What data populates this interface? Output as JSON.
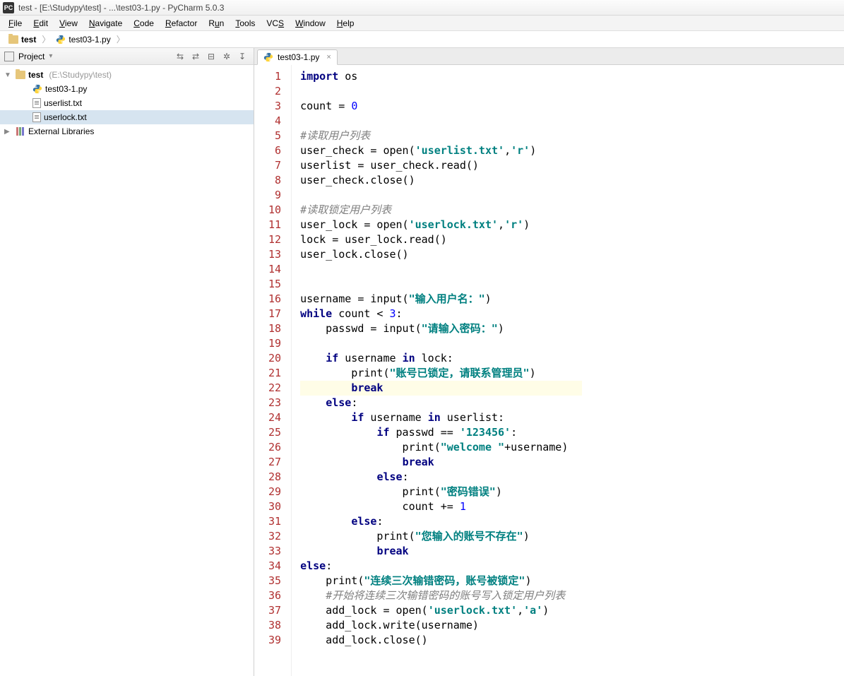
{
  "window": {
    "app_icon_text": "PC",
    "title": "test - [E:\\Studypy\\test] - ...\\test03-1.py - PyCharm 5.0.3"
  },
  "menu": [
    "File",
    "Edit",
    "View",
    "Navigate",
    "Code",
    "Refactor",
    "Run",
    "Tools",
    "VCS",
    "Window",
    "Help"
  ],
  "breadcrumb": {
    "root": "test",
    "file": "test03-1.py"
  },
  "sidebar": {
    "header": {
      "label": "Project",
      "combo": "Project"
    },
    "tree": {
      "root_name": "test",
      "root_path": "(E:\\Studypy\\test)",
      "children": [
        "test03-1.py",
        "userlist.txt",
        "userlock.txt"
      ],
      "external": "External Libraries"
    }
  },
  "editor": {
    "tab_label": "test03-1.py",
    "highlight_line": 22,
    "lines": 39
  },
  "code": {
    "l1": {
      "kw1": "import",
      "t": " os"
    },
    "l3": {
      "t1": "count = ",
      "n": "0"
    },
    "l5": "#读取用户列表",
    "l6": {
      "t1": "user_check = open(",
      "s1": "'userlist.txt'",
      "t2": ",",
      "s2": "'r'",
      "t3": ")"
    },
    "l7": "userlist = user_check.read()",
    "l8": "user_check.close()",
    "l10": "#读取锁定用户列表",
    "l11": {
      "t1": "user_lock = open(",
      "s1": "'userlock.txt'",
      "t2": ",",
      "s2": "'r'",
      "t3": ")"
    },
    "l12": "lock = user_lock.read()",
    "l13": "user_lock.close()",
    "l16": {
      "t1": "username = input(",
      "s": "\"输入用户名：\"",
      "t2": ")"
    },
    "l17": {
      "kw": "while",
      "t1": " count < ",
      "n": "3",
      "t2": ":"
    },
    "l18": {
      "pad": "    ",
      "t1": "passwd = input(",
      "s": "\"请输入密码：\"",
      "t2": ")"
    },
    "l20": {
      "pad": "    ",
      "kw1": "if",
      "t1": " username ",
      "kw2": "in",
      "t2": " lock:"
    },
    "l21": {
      "pad": "        ",
      "t1": "print(",
      "s": "\"账号已锁定，请联系管理员\"",
      "t2": ")"
    },
    "l22": {
      "pad": "        ",
      "kw": "break"
    },
    "l23": {
      "pad": "    ",
      "kw": "else",
      "t": ":"
    },
    "l24": {
      "pad": "        ",
      "kw1": "if",
      "t1": " username ",
      "kw2": "in",
      "t2": " userlist:"
    },
    "l25": {
      "pad": "            ",
      "kw": "if",
      "t1": " passwd == ",
      "s": "'123456'",
      "t2": ":"
    },
    "l26": {
      "pad": "                ",
      "t1": "print(",
      "s": "\"welcome \"",
      "t2": "+username)"
    },
    "l27": {
      "pad": "                ",
      "kw": "break"
    },
    "l28": {
      "pad": "            ",
      "kw": "else",
      "t": ":"
    },
    "l29": {
      "pad": "                ",
      "t1": "print(",
      "s": "\"密码错误\"",
      "t2": ")"
    },
    "l30": {
      "pad": "                ",
      "t1": "count += ",
      "n": "1"
    },
    "l31": {
      "pad": "        ",
      "kw": "else",
      "t": ":"
    },
    "l32": {
      "pad": "            ",
      "t1": "print(",
      "s": "\"您输入的账号不存在\"",
      "t2": ")"
    },
    "l33": {
      "pad": "            ",
      "kw": "break"
    },
    "l34": {
      "kw": "else",
      "t": ":"
    },
    "l35": {
      "pad": "    ",
      "t1": "print(",
      "s": "\"连续三次输错密码，账号被锁定\"",
      "t2": ")"
    },
    "l36": {
      "pad": "    ",
      "c": "#开始将连续三次输错密码的账号写入锁定用户列表"
    },
    "l37": {
      "pad": "    ",
      "t1": "add_lock = open(",
      "s1": "'userlock.txt'",
      "t2": ",",
      "s2": "'a'",
      "t3": ")"
    },
    "l38": "    add_lock.write(username)",
    "l39": "    add_lock.close()"
  }
}
